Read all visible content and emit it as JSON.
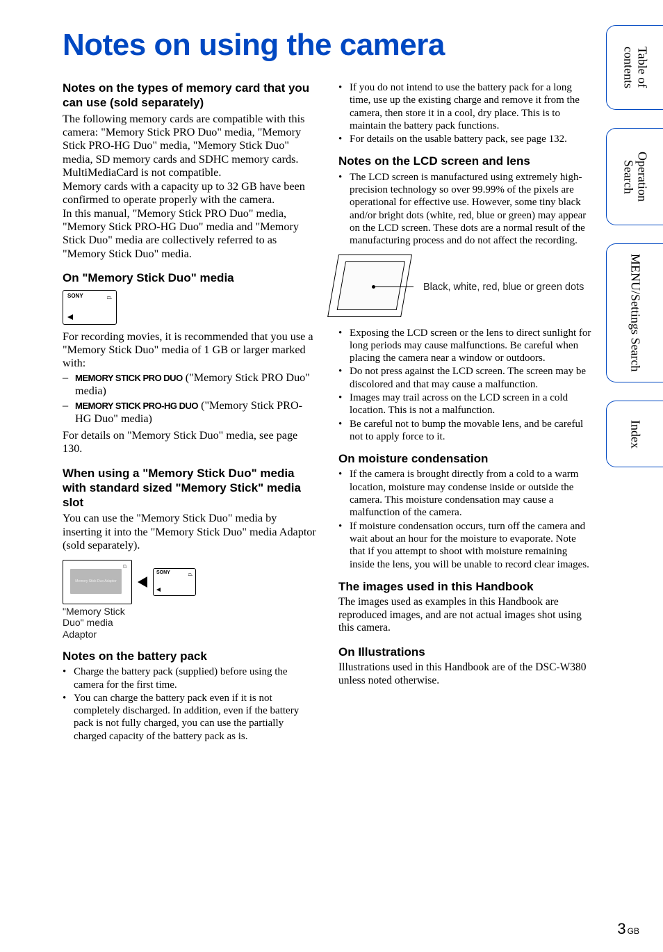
{
  "title": "Notes on using the camera",
  "left": {
    "h1": "Notes on the types of memory card that you can use (sold separately)",
    "p1": "The following memory cards are compatible with this camera: \"Memory Stick PRO Duo\" media, \"Memory Stick PRO-HG Duo\" media, \"Memory Stick Duo\" media, SD memory cards and SDHC memory cards. MultiMediaCard is not compatible.",
    "p1b": "Memory cards with a capacity up to 32 GB have been confirmed to operate properly with the camera.",
    "p1c": "In this manual, \"Memory Stick PRO Duo\" media, \"Memory Stick PRO-HG Duo\" media and \"Memory Stick Duo\" media are collectively referred to as \"Memory Stick Duo\" media.",
    "h2": "On \"Memory Stick Duo\" media",
    "p2": "For recording movies, it is recommended that you use a \"Memory Stick Duo\" media of 1 GB or larger marked with:",
    "dash1_logo": "MEMORY STICK PRO DUO",
    "dash1_tail": " (\"Memory Stick PRO Duo\" media)",
    "dash2_logo": "MEMORY STICK PRO-HG DUO",
    "dash2_tail": " (\"Memory Stick PRO-HG Duo\" media)",
    "p3": "For details on \"Memory Stick Duo\" media, see page 130.",
    "h3": "When using a \"Memory Stick Duo\" media with standard sized \"Memory Stick\" media slot",
    "p4": "You can use the \"Memory Stick Duo\" media by inserting it into the \"Memory Stick Duo\" media Adaptor (sold separately).",
    "adaptor_caption": "\"Memory Stick Duo\" media Adaptor",
    "h4": "Notes on the battery pack",
    "b1": "Charge the battery pack (supplied) before using the camera for the first time.",
    "b2": "You can charge the battery pack even if it is not completely discharged. In addition, even if the battery pack is not fully charged, you can use the partially charged capacity of the battery pack as is."
  },
  "right": {
    "b1": "If you do not intend to use the battery pack for a long time, use up the existing charge and remove it from the camera, then store it in a cool, dry place. This is to maintain the battery pack functions.",
    "b2": "For details on the usable battery pack, see page 132.",
    "h1": "Notes on the LCD screen and lens",
    "b3": "The LCD screen is manufactured using extremely high-precision technology so over 99.99% of the pixels are operational for effective use. However, some tiny black and/or bright dots (white, red, blue or green) may appear on the LCD screen. These dots are a normal result of the manufacturing process and do not affect the recording.",
    "diagram_caption": "Black, white, red, blue or green dots",
    "b4": "Exposing the LCD screen or the lens to direct sunlight for long periods may cause malfunctions. Be careful when placing the camera near a window or outdoors.",
    "b5": "Do not press against the LCD screen. The screen may be discolored and that may cause a malfunction.",
    "b6": "Images may trail across on the LCD screen in a cold location. This is not a malfunction.",
    "b7": "Be careful not to bump the movable lens, and be careful not to apply force to it.",
    "h2": "On moisture condensation",
    "b8": "If the camera is brought directly from a cold to a warm location, moisture may condense inside or outside the camera. This moisture condensation may cause a malfunction of the camera.",
    "b9": "If moisture condensation occurs, turn off the camera and wait about an hour for the moisture to evaporate. Note that if you attempt to shoot with moisture remaining inside the lens, you will be unable to record clear images.",
    "h3": "The images used in this Handbook",
    "p1": "The images used as examples in this Handbook are reproduced images, and are not actual images shot using this camera.",
    "h4": "On Illustrations",
    "p2": "Illustrations used in this Handbook are of the DSC-W380 unless noted otherwise."
  },
  "sidebar": {
    "tab1": "Table of contents",
    "tab2": "Operation Search",
    "tab3": "MENU/Settings Search",
    "tab4": "Index"
  },
  "page": {
    "num": "3",
    "suffix": "GB"
  },
  "card_brand": "SONY",
  "card_notch": "⏢"
}
